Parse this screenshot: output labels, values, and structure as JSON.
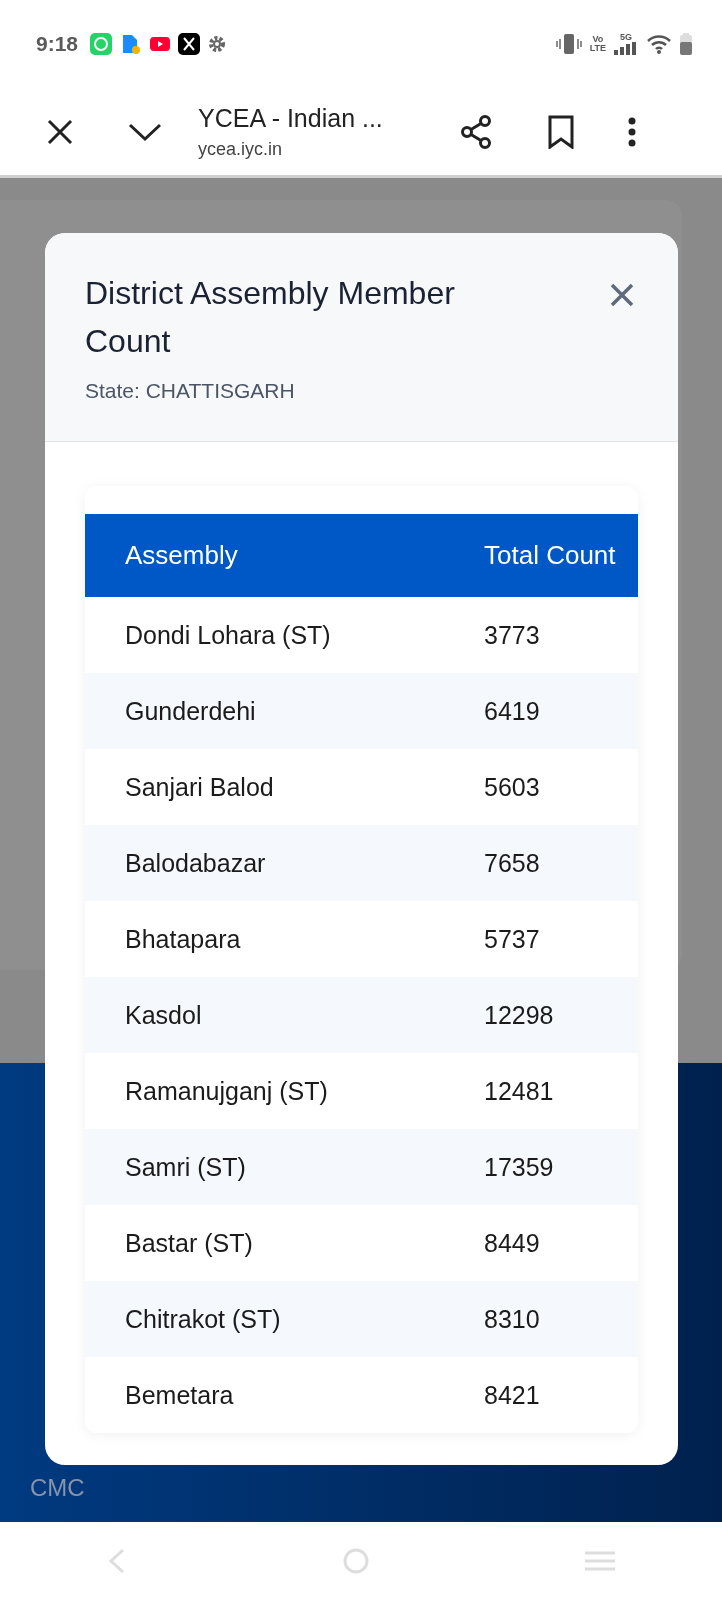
{
  "status_bar": {
    "time": "9:18",
    "network_top": "Vo",
    "network_bottom": "LTE",
    "network_type": "5G"
  },
  "browser": {
    "title": "YCEA - Indian ...",
    "url": "ycea.iyc.in"
  },
  "footer": {
    "texts": [
      "CMC"
    ]
  },
  "modal": {
    "title": "District Assembly Member Count",
    "subtitle": "State: CHATTISGARH",
    "table": {
      "columns": [
        "Assembly",
        "Total Count"
      ],
      "rows": [
        [
          "Dondi Lohara (ST)",
          "3773"
        ],
        [
          "Gunderdehi",
          "6419"
        ],
        [
          "Sanjari Balod",
          "5603"
        ],
        [
          "Balodabazar",
          "7658"
        ],
        [
          "Bhatapara",
          "5737"
        ],
        [
          "Kasdol",
          "12298"
        ],
        [
          "Ramanujganj (ST)",
          "12481"
        ],
        [
          "Samri (ST)",
          "17359"
        ],
        [
          "Bastar (ST)",
          "8449"
        ],
        [
          "Chitrakot (ST)",
          "8310"
        ],
        [
          "Bemetara",
          "8421"
        ]
      ]
    }
  }
}
